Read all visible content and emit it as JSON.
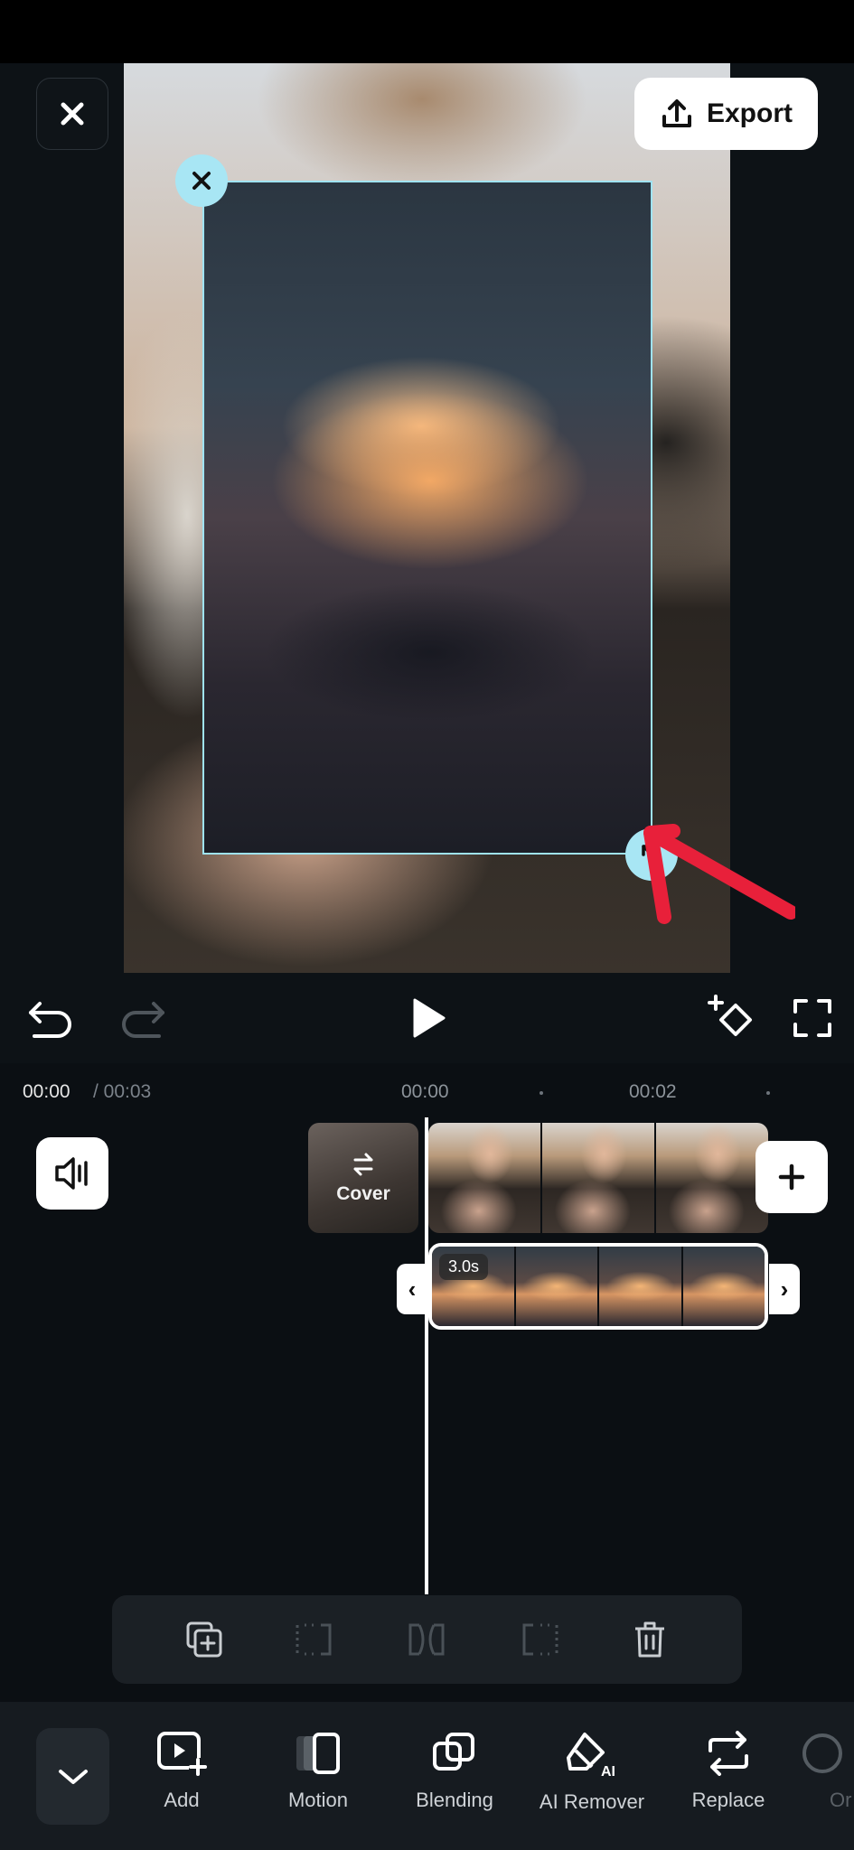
{
  "header": {
    "export_label": "Export"
  },
  "timeline": {
    "current_time": "00:00",
    "total_time": "/ 00:03",
    "ruler_labels": [
      "00:00",
      "00:02"
    ],
    "cover_label": "Cover",
    "overlay_duration": "3.0s",
    "overlay_left_handle": "‹",
    "overlay_right_handle": "›"
  },
  "bottom_tools": [
    {
      "label": "Add",
      "icon": "add-media-icon"
    },
    {
      "label": "Motion",
      "icon": "motion-icon"
    },
    {
      "label": "Blending",
      "icon": "blending-icon"
    },
    {
      "label": "AI Remover",
      "icon": "ai-remover-icon"
    },
    {
      "label": "Replace",
      "icon": "replace-icon"
    },
    {
      "label": "Or",
      "icon": "opacity-icon"
    }
  ],
  "colors": {
    "background": "#0b0f13",
    "selection_accent": "#a8e6f4",
    "annotation_arrow": "#e8203a",
    "button_white": "#ffffff"
  }
}
